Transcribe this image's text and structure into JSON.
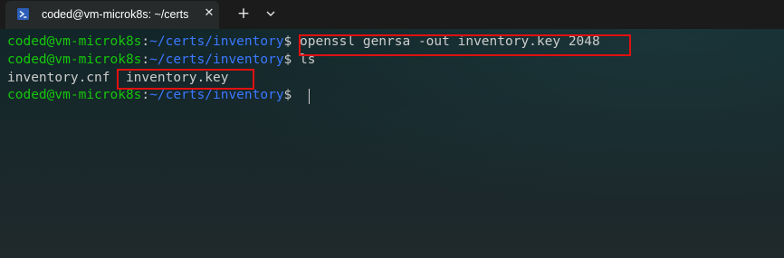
{
  "window": {
    "tab_title": "coded@vm-microk8s: ~/certs",
    "tab_icon": "powershell-icon",
    "close_glyph": "✕",
    "new_tab_glyph": "+",
    "dropdown_icon": "chevron-down-icon"
  },
  "terminal": {
    "lines": [
      {
        "user": "coded@vm-microk8s",
        "sep": ":",
        "path": "~/certs/inventory",
        "dollar": "$",
        "command": " openssl genrsa -out inventory.key 2048"
      },
      {
        "user": "coded@vm-microk8s",
        "sep": ":",
        "path": "~/certs/inventory",
        "dollar": "$",
        "command": " ls"
      },
      {
        "output": "inventory.cnf  inventory.key"
      },
      {
        "user": "coded@vm-microk8s",
        "sep": ":",
        "path": "~/certs/inventory",
        "dollar": "$",
        "command": " "
      }
    ]
  },
  "colors": {
    "user": "#16c60c",
    "path": "#3b78ff",
    "text": "#cccccc",
    "highlight": "#e01010"
  }
}
